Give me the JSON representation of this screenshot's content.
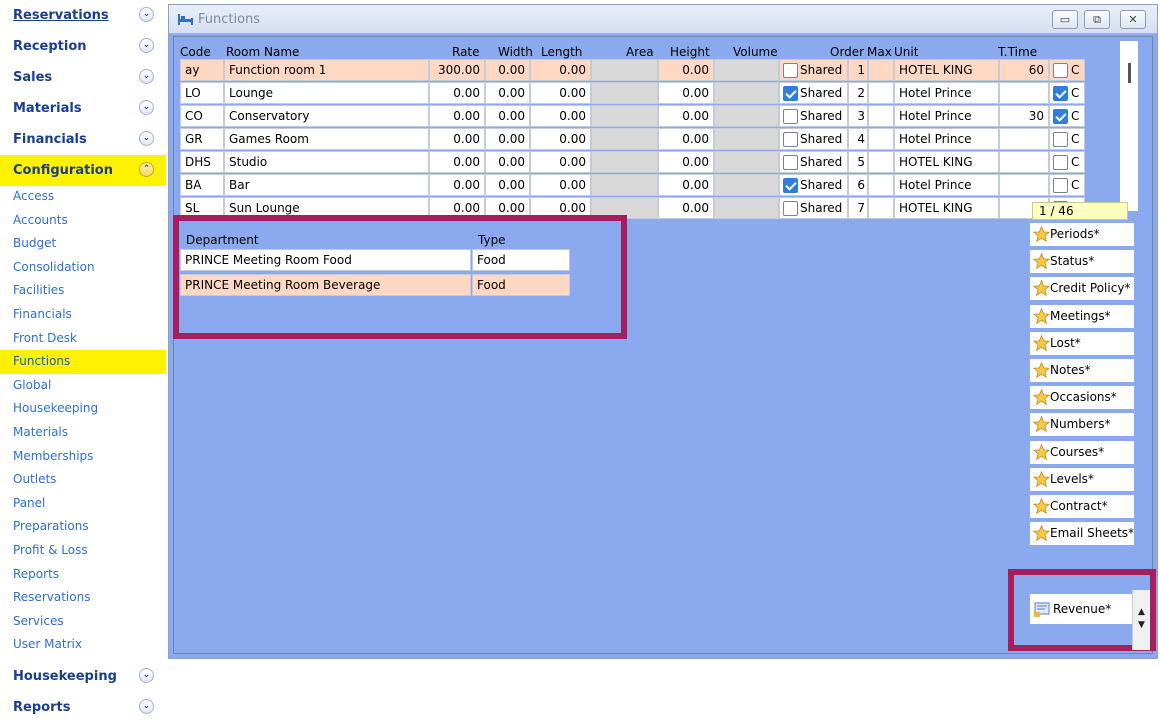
{
  "sidebar": {
    "sections_top": [
      {
        "label": "Reservations",
        "underline": true
      },
      {
        "label": "Reception"
      },
      {
        "label": "Sales"
      },
      {
        "label": "Materials"
      },
      {
        "label": "Financials"
      }
    ],
    "active_section": {
      "label": "Configuration"
    },
    "config_items": [
      "Access",
      "Accounts",
      "Budget",
      "Consolidation",
      "Facilities",
      "Financials",
      "Front Desk",
      "Functions",
      "Global",
      "Housekeeping",
      "Materials",
      "Memberships",
      "Outlets",
      "Panel",
      "Preparations",
      "Profit & Loss",
      "Reports",
      "Reservations",
      "Services",
      "User Matrix"
    ],
    "active_item": "Functions",
    "sections_bottom": [
      {
        "label": "Housekeeping"
      },
      {
        "label": "Reports"
      }
    ]
  },
  "window": {
    "title": "Functions",
    "minimize_glyph": "▭",
    "restore_glyph": "⧉",
    "close_glyph": "✕"
  },
  "grid": {
    "headers": {
      "code": "Code",
      "room_name": "Room Name",
      "rate": "Rate",
      "width": "Width",
      "length": "Length",
      "area": "Area",
      "height": "Height",
      "volume": "Volume",
      "order": "Order",
      "max": "Max",
      "unit": "Unit",
      "ttime": "T.Time"
    },
    "shared_label": "Shared",
    "rows": [
      {
        "code": "ay",
        "name": "Function room 1",
        "rate": "300.00",
        "width": "0.00",
        "length": "0.00",
        "height": "0.00",
        "shared": false,
        "order": "1",
        "unit": "HOTEL KING",
        "ttime": "60",
        "c": false,
        "c_label": "C",
        "selected": true
      },
      {
        "code": "LO",
        "name": "Lounge",
        "rate": "0.00",
        "width": "0.00",
        "length": "0.00",
        "height": "0.00",
        "shared": true,
        "order": "2",
        "unit": "Hotel Prince",
        "ttime": "",
        "c": true,
        "c_label": "C",
        "selected": false
      },
      {
        "code": "CO",
        "name": "Conservatory",
        "rate": "0.00",
        "width": "0.00",
        "length": "0.00",
        "height": "0.00",
        "shared": false,
        "order": "3",
        "unit": "Hotel Prince",
        "ttime": "30",
        "c": true,
        "c_label": "C",
        "selected": false
      },
      {
        "code": "GR",
        "name": "Games Room",
        "rate": "0.00",
        "width": "0.00",
        "length": "0.00",
        "height": "0.00",
        "shared": false,
        "order": "4",
        "unit": "Hotel Prince",
        "ttime": "",
        "c": false,
        "c_label": "C",
        "selected": false
      },
      {
        "code": "DHS",
        "name": "Studio",
        "rate": "0.00",
        "width": "0.00",
        "length": "0.00",
        "height": "0.00",
        "shared": false,
        "order": "5",
        "unit": "HOTEL KING",
        "ttime": "",
        "c": false,
        "c_label": "C",
        "selected": false
      },
      {
        "code": "BA",
        "name": "Bar",
        "rate": "0.00",
        "width": "0.00",
        "length": "0.00",
        "height": "0.00",
        "shared": true,
        "order": "6",
        "unit": "Hotel Prince",
        "ttime": "",
        "c": false,
        "c_label": "C",
        "selected": false
      },
      {
        "code": "SL",
        "name": "Sun Lounge",
        "rate": "0.00",
        "width": "0.00",
        "length": "0.00",
        "height": "0.00",
        "shared": false,
        "order": "7",
        "unit": "HOTEL KING",
        "ttime": "",
        "c": false,
        "c_label": "C",
        "selected": false
      }
    ],
    "record_count": "1 / 46"
  },
  "department": {
    "headers": {
      "department": "Department",
      "type": "Type"
    },
    "rows": [
      {
        "department": "PRINCE Meeting Room Food",
        "type": "Food",
        "selected": false
      },
      {
        "department": "PRINCE Meeting Room Beverage",
        "type": "Food",
        "selected": true
      }
    ]
  },
  "side_buttons": [
    "Periods*",
    "Status*",
    "Credit Policy*",
    "Meetings*",
    "Lost*",
    "Notes*",
    "Occasions*",
    "Numbers*",
    "Courses*",
    "Levels*",
    "Contract*",
    "Email Sheets*"
  ],
  "revenue_button": "Revenue*",
  "colors": {
    "highlight_box": "#a51e5e",
    "client_bg": "#8aa9ee",
    "selected_row": "#ffd8c4",
    "active_nav": "#fff200"
  }
}
